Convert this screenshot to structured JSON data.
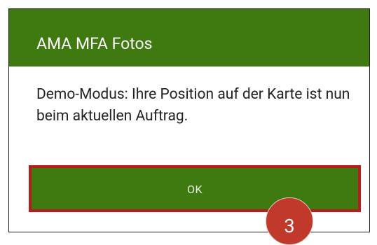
{
  "dialog": {
    "title": "AMA MFA Fotos",
    "message": "Demo-Modus: Ihre Position auf der Karte ist nun beim aktuellen Auftrag.",
    "ok_label": "OK"
  },
  "annotation": {
    "step_number": "3"
  },
  "colors": {
    "header_green": "#3f7a10",
    "button_green": "#3f7a10",
    "highlight_red": "#b81d1d",
    "badge_red": "#c0392b"
  }
}
